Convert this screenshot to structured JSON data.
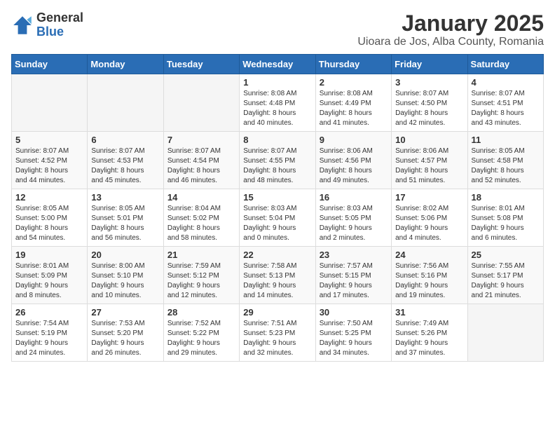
{
  "header": {
    "logo_general": "General",
    "logo_blue": "Blue",
    "title": "January 2025",
    "subtitle": "Uioara de Jos, Alba County, Romania"
  },
  "calendar": {
    "weekdays": [
      "Sunday",
      "Monday",
      "Tuesday",
      "Wednesday",
      "Thursday",
      "Friday",
      "Saturday"
    ],
    "weeks": [
      [
        {
          "day": "",
          "info": ""
        },
        {
          "day": "",
          "info": ""
        },
        {
          "day": "",
          "info": ""
        },
        {
          "day": "1",
          "info": "Sunrise: 8:08 AM\nSunset: 4:48 PM\nDaylight: 8 hours\nand 40 minutes."
        },
        {
          "day": "2",
          "info": "Sunrise: 8:08 AM\nSunset: 4:49 PM\nDaylight: 8 hours\nand 41 minutes."
        },
        {
          "day": "3",
          "info": "Sunrise: 8:07 AM\nSunset: 4:50 PM\nDaylight: 8 hours\nand 42 minutes."
        },
        {
          "day": "4",
          "info": "Sunrise: 8:07 AM\nSunset: 4:51 PM\nDaylight: 8 hours\nand 43 minutes."
        }
      ],
      [
        {
          "day": "5",
          "info": "Sunrise: 8:07 AM\nSunset: 4:52 PM\nDaylight: 8 hours\nand 44 minutes."
        },
        {
          "day": "6",
          "info": "Sunrise: 8:07 AM\nSunset: 4:53 PM\nDaylight: 8 hours\nand 45 minutes."
        },
        {
          "day": "7",
          "info": "Sunrise: 8:07 AM\nSunset: 4:54 PM\nDaylight: 8 hours\nand 46 minutes."
        },
        {
          "day": "8",
          "info": "Sunrise: 8:07 AM\nSunset: 4:55 PM\nDaylight: 8 hours\nand 48 minutes."
        },
        {
          "day": "9",
          "info": "Sunrise: 8:06 AM\nSunset: 4:56 PM\nDaylight: 8 hours\nand 49 minutes."
        },
        {
          "day": "10",
          "info": "Sunrise: 8:06 AM\nSunset: 4:57 PM\nDaylight: 8 hours\nand 51 minutes."
        },
        {
          "day": "11",
          "info": "Sunrise: 8:05 AM\nSunset: 4:58 PM\nDaylight: 8 hours\nand 52 minutes."
        }
      ],
      [
        {
          "day": "12",
          "info": "Sunrise: 8:05 AM\nSunset: 5:00 PM\nDaylight: 8 hours\nand 54 minutes."
        },
        {
          "day": "13",
          "info": "Sunrise: 8:05 AM\nSunset: 5:01 PM\nDaylight: 8 hours\nand 56 minutes."
        },
        {
          "day": "14",
          "info": "Sunrise: 8:04 AM\nSunset: 5:02 PM\nDaylight: 8 hours\nand 58 minutes."
        },
        {
          "day": "15",
          "info": "Sunrise: 8:03 AM\nSunset: 5:04 PM\nDaylight: 9 hours\nand 0 minutes."
        },
        {
          "day": "16",
          "info": "Sunrise: 8:03 AM\nSunset: 5:05 PM\nDaylight: 9 hours\nand 2 minutes."
        },
        {
          "day": "17",
          "info": "Sunrise: 8:02 AM\nSunset: 5:06 PM\nDaylight: 9 hours\nand 4 minutes."
        },
        {
          "day": "18",
          "info": "Sunrise: 8:01 AM\nSunset: 5:08 PM\nDaylight: 9 hours\nand 6 minutes."
        }
      ],
      [
        {
          "day": "19",
          "info": "Sunrise: 8:01 AM\nSunset: 5:09 PM\nDaylight: 9 hours\nand 8 minutes."
        },
        {
          "day": "20",
          "info": "Sunrise: 8:00 AM\nSunset: 5:10 PM\nDaylight: 9 hours\nand 10 minutes."
        },
        {
          "day": "21",
          "info": "Sunrise: 7:59 AM\nSunset: 5:12 PM\nDaylight: 9 hours\nand 12 minutes."
        },
        {
          "day": "22",
          "info": "Sunrise: 7:58 AM\nSunset: 5:13 PM\nDaylight: 9 hours\nand 14 minutes."
        },
        {
          "day": "23",
          "info": "Sunrise: 7:57 AM\nSunset: 5:15 PM\nDaylight: 9 hours\nand 17 minutes."
        },
        {
          "day": "24",
          "info": "Sunrise: 7:56 AM\nSunset: 5:16 PM\nDaylight: 9 hours\nand 19 minutes."
        },
        {
          "day": "25",
          "info": "Sunrise: 7:55 AM\nSunset: 5:17 PM\nDaylight: 9 hours\nand 21 minutes."
        }
      ],
      [
        {
          "day": "26",
          "info": "Sunrise: 7:54 AM\nSunset: 5:19 PM\nDaylight: 9 hours\nand 24 minutes."
        },
        {
          "day": "27",
          "info": "Sunrise: 7:53 AM\nSunset: 5:20 PM\nDaylight: 9 hours\nand 26 minutes."
        },
        {
          "day": "28",
          "info": "Sunrise: 7:52 AM\nSunset: 5:22 PM\nDaylight: 9 hours\nand 29 minutes."
        },
        {
          "day": "29",
          "info": "Sunrise: 7:51 AM\nSunset: 5:23 PM\nDaylight: 9 hours\nand 32 minutes."
        },
        {
          "day": "30",
          "info": "Sunrise: 7:50 AM\nSunset: 5:25 PM\nDaylight: 9 hours\nand 34 minutes."
        },
        {
          "day": "31",
          "info": "Sunrise: 7:49 AM\nSunset: 5:26 PM\nDaylight: 9 hours\nand 37 minutes."
        },
        {
          "day": "",
          "info": ""
        }
      ]
    ]
  }
}
